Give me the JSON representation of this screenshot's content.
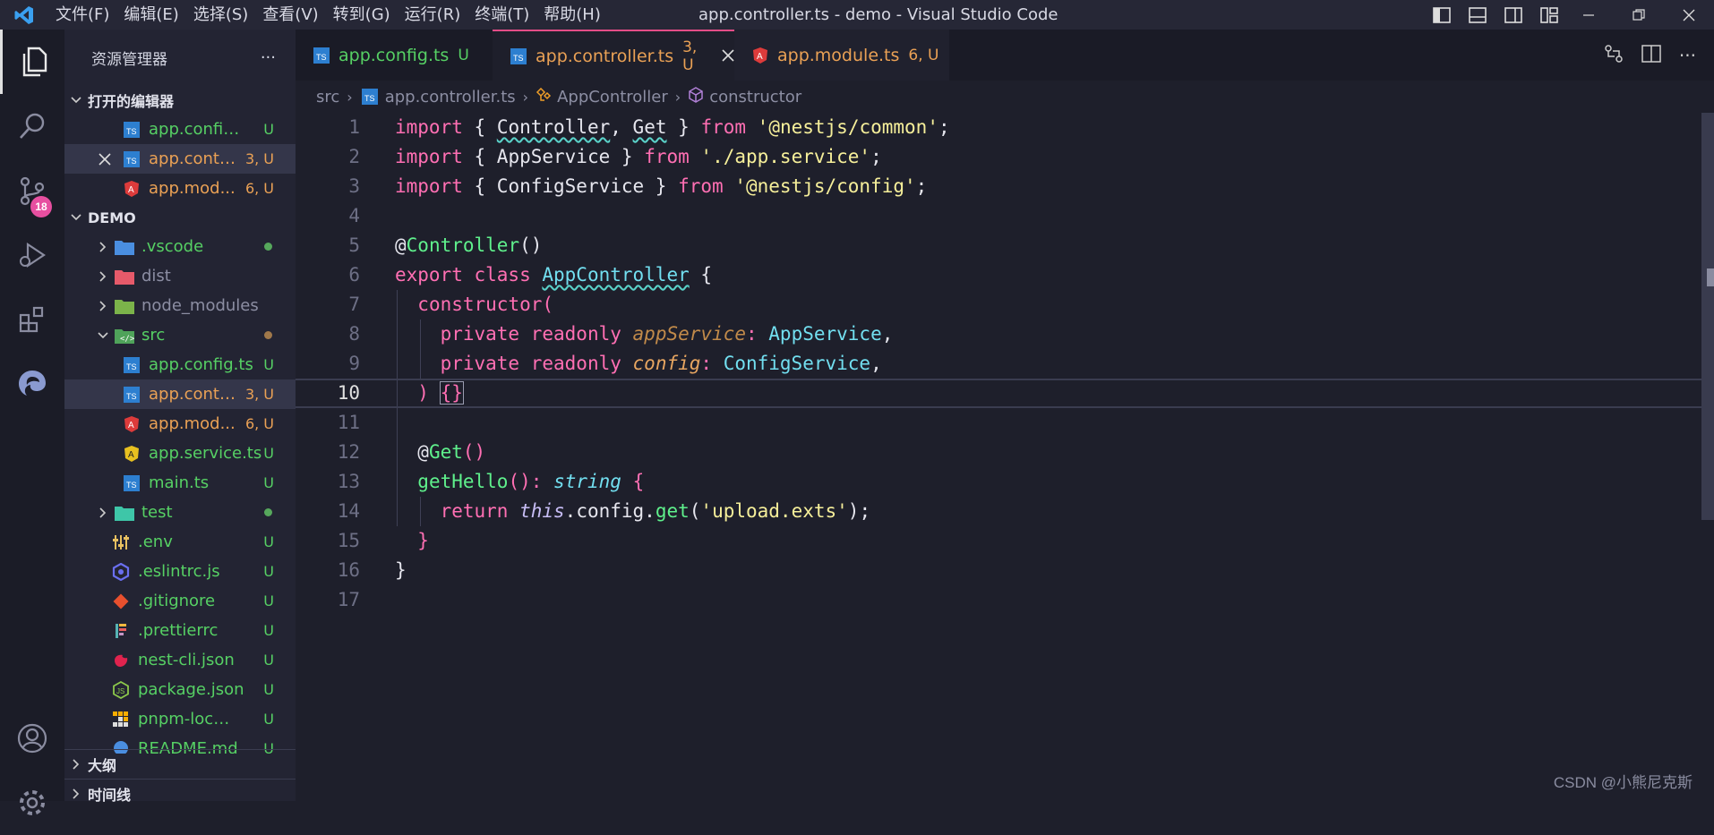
{
  "menu": [
    "文件(F)",
    "编辑(E)",
    "选择(S)",
    "查看(V)",
    "转到(G)",
    "运行(R)",
    "终端(T)",
    "帮助(H)"
  ],
  "window_title": "app.controller.ts - demo - Visual Studio Code",
  "activity": {
    "scm_badge": "18"
  },
  "sidebar": {
    "title": "资源管理器",
    "more": "···",
    "open_editors_title": "打开的编辑器",
    "open_editors": [
      {
        "name": "app.config.t...",
        "status": "U"
      },
      {
        "name": "app.contr...",
        "status": "3, U"
      },
      {
        "name": "app.mod...",
        "status": "6, U"
      }
    ],
    "project_title": "DEMO",
    "tree": [
      {
        "name": ".vscode"
      },
      {
        "name": "dist"
      },
      {
        "name": "node_modules"
      },
      {
        "name": "src"
      },
      {
        "name": "app.config.ts",
        "status": "U"
      },
      {
        "name": "app.contr...",
        "status": "3, U"
      },
      {
        "name": "app.mod...",
        "status": "6, U"
      },
      {
        "name": "app.service.ts",
        "status": "U"
      },
      {
        "name": "main.ts",
        "status": "U"
      },
      {
        "name": "test"
      },
      {
        "name": ".env",
        "status": "U"
      },
      {
        "name": ".eslintrc.js",
        "status": "U"
      },
      {
        "name": ".gitignore",
        "status": "U"
      },
      {
        "name": ".prettierrc",
        "status": "U"
      },
      {
        "name": "nest-cli.json",
        "status": "U"
      },
      {
        "name": "package.json",
        "status": "U"
      },
      {
        "name": "pnpm-lock.y...",
        "status": "U"
      },
      {
        "name": "README.md",
        "status": "U"
      }
    ],
    "outline_title": "大纲",
    "timeline_title": "时间线"
  },
  "tabs": [
    {
      "label": "app.config.ts",
      "status": "U"
    },
    {
      "label": "app.controller.ts",
      "status": "3, U"
    },
    {
      "label": "app.module.ts",
      "status": "6, U"
    }
  ],
  "breadcrumb": {
    "folder": "src",
    "file": "app.controller.ts",
    "class": "AppController",
    "member": "constructor"
  },
  "editor": {
    "line_numbers": [
      "1",
      "2",
      "3",
      "4",
      "5",
      "6",
      "7",
      "8",
      "9",
      "10",
      "11",
      "12",
      "13",
      "14",
      "15",
      "16",
      "17"
    ],
    "current_line": "10"
  },
  "watermark": "CSDN @小熊尼克斯",
  "colors": {
    "accent": "#e34d87",
    "untracked": "#56d064",
    "modified": "#eaa155",
    "keyword": "#ff6fb3",
    "type": "#72dff0",
    "string": "#f6ef9a",
    "function": "#5ff08c"
  }
}
